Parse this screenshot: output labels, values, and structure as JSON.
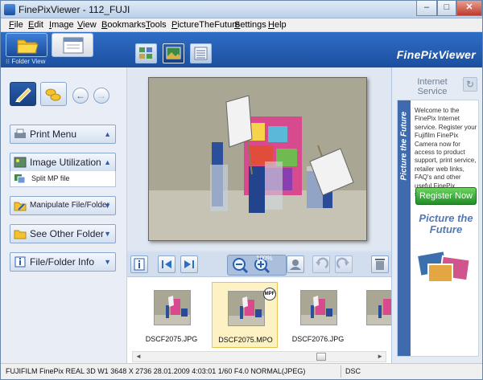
{
  "window": {
    "title": "FinePixViewer  - 112_FUJI",
    "controls": {
      "minimize": "–",
      "maximize": "□",
      "close": "✕"
    }
  },
  "menubar": {
    "items": [
      {
        "label": "File"
      },
      {
        "label": "Edit"
      },
      {
        "label": "Image"
      },
      {
        "label": "View"
      },
      {
        "label": "Bookmarks"
      },
      {
        "label": "Tools"
      },
      {
        "label": "PictureTheFuture"
      },
      {
        "label": "Settings"
      },
      {
        "label": "Help"
      }
    ]
  },
  "toolbar": {
    "folder_view_label": "Folder View",
    "brand": "FinePixViewer",
    "views": [
      {
        "name": "thumbnails-icon"
      },
      {
        "name": "single-image-icon",
        "active": true
      },
      {
        "name": "list-icon"
      }
    ]
  },
  "left_panel": {
    "sections": [
      {
        "label": "Print Menu",
        "arrow": "▲"
      },
      {
        "label": "Image Utilization",
        "arrow": "▲"
      },
      {
        "label": "Manipulate File/Folder",
        "arrow": "▼"
      },
      {
        "label": "See Other Folder",
        "arrow": "▼"
      },
      {
        "label": "File/Folder Info",
        "arrow": "▼"
      }
    ],
    "submenu_item": "Split MP file",
    "nav": {
      "back": "←",
      "forward": "→"
    }
  },
  "center": {
    "zoom_percent": "100%",
    "thumbnails": [
      {
        "name": "DSCF2075.JPG",
        "selected": false,
        "badge": ""
      },
      {
        "name": "DSCF2075.MPO",
        "selected": true,
        "badge": "MPF"
      },
      {
        "name": "DSCF2076.JPG",
        "selected": false,
        "badge": ""
      },
      {
        "name": "",
        "selected": false,
        "badge": ""
      }
    ],
    "scroll": {
      "left": "◄",
      "right": "►"
    }
  },
  "right_panel": {
    "header": "Internet Service",
    "refresh_icon": "↻",
    "banner_vertical": "Picture the Future",
    "body_text": "Welcome to the FinePix Internet service. Register your Fujifilm FinePix Camera now for access to product support, print service, retailer web links, FAQ's and other useful FinePix services.",
    "register_button": "Register Now",
    "logo_text": "Picture the Future"
  },
  "statusbar": {
    "info": "FUJIFILM FinePix REAL 3D W1   3648 X 2736  28.01.2009 4:03:01  1/60  F4.0   NORMAL(JPEG)",
    "mode": "DSC"
  },
  "colors": {
    "toolbar_blue": "#2f6ec7",
    "accent_green": "#1f8f27",
    "selection_yellow": "#fdf2c4"
  }
}
